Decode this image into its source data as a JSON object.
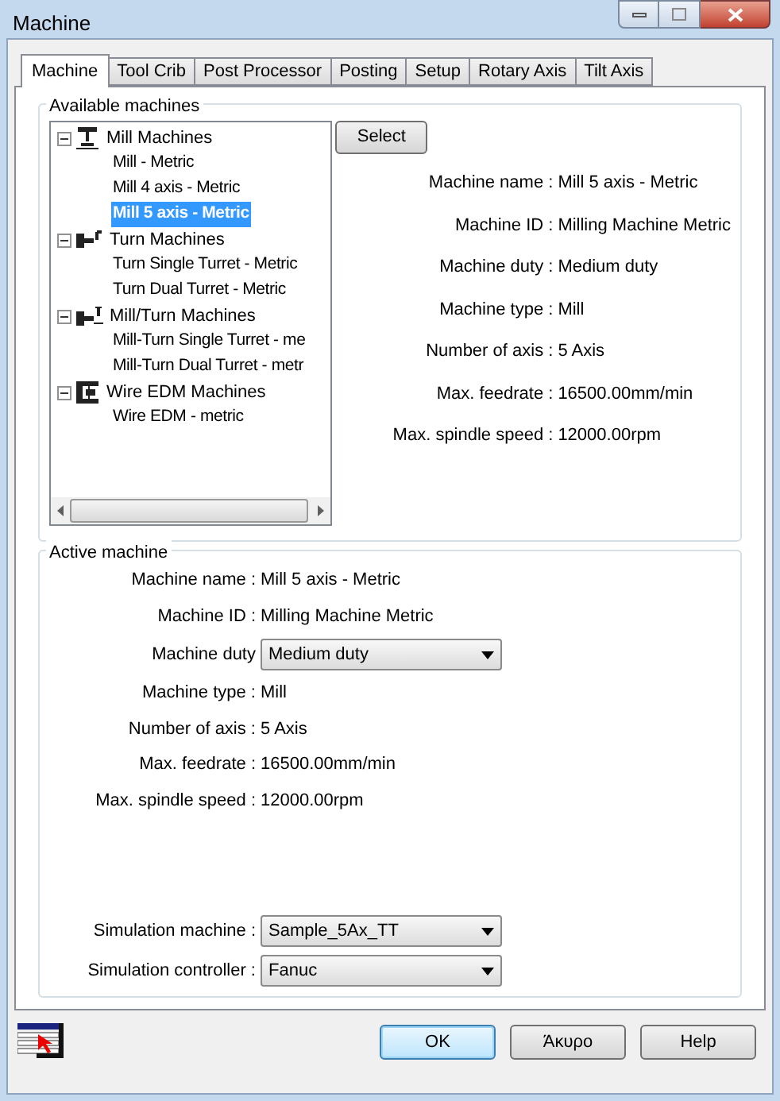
{
  "window": {
    "title": "Machine"
  },
  "tabs": [
    {
      "label": "Machine",
      "selected": true
    },
    {
      "label": "Tool Crib",
      "selected": false
    },
    {
      "label": "Post Processor",
      "selected": false
    },
    {
      "label": "Posting",
      "selected": false
    },
    {
      "label": "Setup",
      "selected": false
    },
    {
      "label": "Rotary Axis",
      "selected": false
    },
    {
      "label": "Tilt Axis",
      "selected": false
    }
  ],
  "available_machines": {
    "title": "Available machines",
    "tree": [
      {
        "label": "Mill Machines",
        "kind": "mill",
        "expanded": true,
        "children": [
          {
            "label": "Mill - Metric",
            "selected": false
          },
          {
            "label": "Mill 4 axis - Metric",
            "selected": false
          },
          {
            "label": "Mill 5 axis - Metric",
            "selected": true
          }
        ]
      },
      {
        "label": "Turn Machines",
        "kind": "turn",
        "expanded": true,
        "children": [
          {
            "label": "Turn Single Turret - Metric",
            "selected": false
          },
          {
            "label": "Turn Dual Turret - Metric",
            "selected": false
          }
        ]
      },
      {
        "label": "Mill/Turn Machines",
        "kind": "millturn",
        "expanded": true,
        "children": [
          {
            "label": "Mill-Turn Single Turret - me",
            "selected": false
          },
          {
            "label": "Mill-Turn Dual Turret - metr",
            "selected": false
          }
        ]
      },
      {
        "label": "Wire EDM Machines",
        "kind": "edm",
        "expanded": true,
        "children": [
          {
            "label": "Wire EDM - metric",
            "selected": false
          }
        ]
      }
    ],
    "select_button": "Select",
    "details": [
      {
        "label": "Machine name :",
        "value": "Mill 5 axis - Metric"
      },
      {
        "label": "Machine ID :",
        "value": "Milling Machine Metric"
      },
      {
        "label": "Machine duty :",
        "value": "Medium duty"
      },
      {
        "label": "Machine type :",
        "value": "Mill"
      },
      {
        "label": "Number of axis :",
        "value": "5 Axis"
      },
      {
        "label": "Max. feedrate :",
        "value": "16500.00mm/min"
      },
      {
        "label": "Max. spindle speed :",
        "value": "12000.00rpm"
      }
    ]
  },
  "active_machine": {
    "title": "Active machine",
    "fields": [
      {
        "label": "Machine name :",
        "value": "Mill 5 axis - Metric",
        "kind": "text"
      },
      {
        "label": "Machine ID :",
        "value": "Milling Machine Metric",
        "kind": "text"
      },
      {
        "label": "Machine duty",
        "value": "Medium duty",
        "kind": "dropdown"
      },
      {
        "label": "Machine type :",
        "value": "Mill",
        "kind": "text"
      },
      {
        "label": "Number of axis :",
        "value": "5 Axis",
        "kind": "text"
      },
      {
        "label": "Max. feedrate :",
        "value": "16500.00mm/min",
        "kind": "text"
      },
      {
        "label": "Max. spindle speed :",
        "value": "12000.00rpm",
        "kind": "text"
      }
    ],
    "simulation": [
      {
        "label": "Simulation machine :",
        "value": "Sample_5Ax_TT",
        "kind": "dropdown"
      },
      {
        "label": "Simulation controller :",
        "value": "Fanuc",
        "kind": "dropdown"
      }
    ]
  },
  "buttons": [
    {
      "label": "OK",
      "selected": true
    },
    {
      "label": "Άκυρο",
      "selected": false
    },
    {
      "label": "Help",
      "selected": false
    }
  ]
}
